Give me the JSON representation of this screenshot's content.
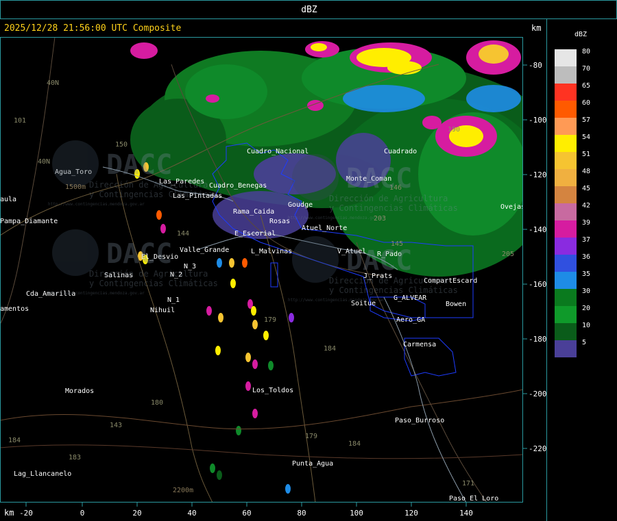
{
  "header": {
    "title": "dBZ",
    "timestamp": "2025/12/28 21:56:00 UTC Composite",
    "km_top": "km",
    "km_bottom": "km"
  },
  "legend": {
    "title": "dBZ",
    "items": [
      {
        "label": "80",
        "color": "#e6e6e6"
      },
      {
        "label": "70",
        "color": "#bdbdbd"
      },
      {
        "label": "65",
        "color": "#ff3322"
      },
      {
        "label": "60",
        "color": "#ff5a00"
      },
      {
        "label": "57",
        "color": "#ff9a55"
      },
      {
        "label": "54",
        "color": "#ffee00"
      },
      {
        "label": "51",
        "color": "#f6c431"
      },
      {
        "label": "48",
        "color": "#f0b040"
      },
      {
        "label": "45",
        "color": "#d48440"
      },
      {
        "label": "42",
        "color": "#c86aa0"
      },
      {
        "label": "39",
        "color": "#d61ca0"
      },
      {
        "label": "37",
        "color": "#8a2be0"
      },
      {
        "label": "36",
        "color": "#3050e0"
      },
      {
        "label": "35",
        "color": "#1e8ce6"
      },
      {
        "label": "30",
        "color": "#0a7a1e"
      },
      {
        "label": "20",
        "color": "#0f9a2a"
      },
      {
        "label": "10",
        "color": "#0a5c1a"
      },
      {
        "label": "5",
        "color": "#4a3f98"
      }
    ]
  },
  "axes": {
    "x_ticks": [
      "-20",
      "0",
      "20",
      "40",
      "60",
      "80",
      "100",
      "120",
      "140"
    ],
    "y_ticks": [
      "-80",
      "-100",
      "-120",
      "-140",
      "-160",
      "-180",
      "-200",
      "-220"
    ]
  },
  "places": [
    {
      "name": "Agua_Toro"
    },
    {
      "name": "Pampa_Diamante"
    },
    {
      "name": "El_Desvio"
    },
    {
      "name": "Salinas"
    },
    {
      "name": "Cda_Amarilla"
    },
    {
      "name": "amentos"
    },
    {
      "name": "Nihuil"
    },
    {
      "name": "N_1"
    },
    {
      "name": "N_2"
    },
    {
      "name": "N_3"
    },
    {
      "name": "Valle_Grande"
    },
    {
      "name": "E_Escorial"
    },
    {
      "name": "L_Malvinas"
    },
    {
      "name": "Atuel_Norte"
    },
    {
      "name": "V_Atuel"
    },
    {
      "name": "R_Pado"
    },
    {
      "name": "J_Prats"
    },
    {
      "name": "G_ALVEAR"
    },
    {
      "name": "CompartEscard"
    },
    {
      "name": "Bowen"
    },
    {
      "name": "Soitue"
    },
    {
      "name": "Aero_GA"
    },
    {
      "name": "Carmensa"
    },
    {
      "name": "Los_Toldos"
    },
    {
      "name": "Morados"
    },
    {
      "name": "Paso_Burroso"
    },
    {
      "name": "Punta_Agua"
    },
    {
      "name": "Lag_Llancanelo"
    },
    {
      "name": "Paso_El_Loro"
    },
    {
      "name": "Cuadro_Nacional"
    },
    {
      "name": "Cuadro_Benegas"
    },
    {
      "name": "Goudge"
    },
    {
      "name": "Rosas"
    },
    {
      "name": "Monte_Coman"
    },
    {
      "name": "Rama_Caida"
    },
    {
      "name": "Las_Paredes"
    },
    {
      "name": "Las_Pintadas"
    },
    {
      "name": "Ovejas"
    },
    {
      "name": "Cuadrado"
    },
    {
      "name": "aula"
    }
  ],
  "route_labels": [
    "40N",
    "101",
    "150",
    "179",
    "184",
    "180",
    "183",
    "143",
    "171",
    "203",
    "146",
    "190",
    "184",
    "184",
    "144",
    "40N",
    "145",
    "205",
    "179"
  ],
  "watermark": {
    "brand": "DACC",
    "line1": "Dirección de Agricultura",
    "line2": "y Contingencias Climáticas",
    "url": "http://www.contingencias.mendoza.gov.ar"
  },
  "terrain_labels": [
    "1500m",
    "2200m"
  ]
}
